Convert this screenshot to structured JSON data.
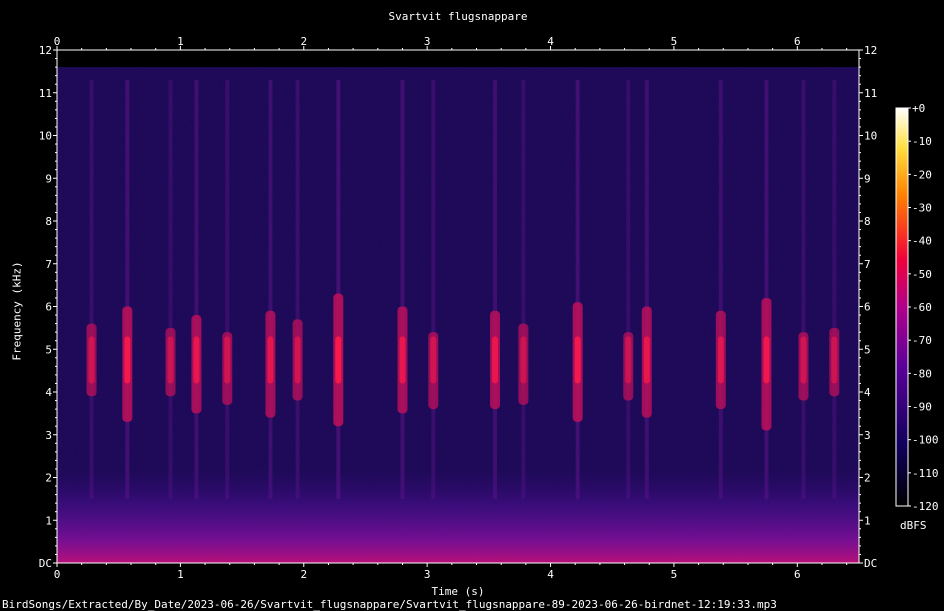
{
  "chart_data": {
    "type": "heatmap",
    "title": "Svartvit flugsnappare",
    "xlabel": "Time (s)",
    "ylabel": "Frequency (kHz)",
    "xlim": [
      0,
      6.5
    ],
    "ylim": [
      0,
      12
    ],
    "x_ticks": [
      "0",
      "1",
      "2",
      "3",
      "4",
      "5",
      "6"
    ],
    "y_ticks": [
      "DC",
      "1",
      "2",
      "3",
      "4",
      "5",
      "6",
      "7",
      "8",
      "9",
      "10",
      "11",
      "12"
    ],
    "colorbar": {
      "label": "dBFS",
      "ticks": [
        "+0",
        "-10",
        "-20",
        "-30",
        "-40",
        "-50",
        "-60",
        "-70",
        "-80",
        "-90",
        "-100",
        "-110",
        "-120"
      ],
      "range": [
        -120,
        0
      ],
      "colors": [
        "#000000",
        "#10005a",
        "#5a009a",
        "#b0008a",
        "#f0003a",
        "#ff8000",
        "#ffe040",
        "#ffffff"
      ]
    },
    "background_color": "#1a0b52",
    "calls": [
      {
        "t": 0.28,
        "f_low": 3.9,
        "f_high": 5.6,
        "level": 0.55
      },
      {
        "t": 0.57,
        "f_low": 3.3,
        "f_high": 6.0,
        "level": 0.85
      },
      {
        "t": 0.92,
        "f_low": 3.9,
        "f_high": 5.5,
        "level": 0.5
      },
      {
        "t": 1.13,
        "f_low": 3.5,
        "f_high": 5.8,
        "level": 0.75
      },
      {
        "t": 1.38,
        "f_low": 3.7,
        "f_high": 5.4,
        "level": 0.55
      },
      {
        "t": 1.73,
        "f_low": 3.4,
        "f_high": 5.9,
        "level": 0.7
      },
      {
        "t": 1.95,
        "f_low": 3.8,
        "f_high": 5.7,
        "level": 0.55
      },
      {
        "t": 2.28,
        "f_low": 3.2,
        "f_high": 6.3,
        "level": 0.9
      },
      {
        "t": 2.8,
        "f_low": 3.5,
        "f_high": 6.0,
        "level": 0.75
      },
      {
        "t": 3.05,
        "f_low": 3.6,
        "f_high": 5.4,
        "level": 0.55
      },
      {
        "t": 3.55,
        "f_low": 3.6,
        "f_high": 5.9,
        "level": 0.75
      },
      {
        "t": 3.78,
        "f_low": 3.7,
        "f_high": 5.6,
        "level": 0.5
      },
      {
        "t": 4.22,
        "f_low": 3.3,
        "f_high": 6.1,
        "level": 0.85
      },
      {
        "t": 4.63,
        "f_low": 3.8,
        "f_high": 5.4,
        "level": 0.5
      },
      {
        "t": 4.78,
        "f_low": 3.4,
        "f_high": 6.0,
        "level": 0.75
      },
      {
        "t": 5.38,
        "f_low": 3.6,
        "f_high": 5.9,
        "level": 0.65
      },
      {
        "t": 5.75,
        "f_low": 3.1,
        "f_high": 6.2,
        "level": 0.8
      },
      {
        "t": 6.05,
        "f_low": 3.8,
        "f_high": 5.4,
        "level": 0.55
      },
      {
        "t": 6.3,
        "f_low": 3.9,
        "f_high": 5.5,
        "level": 0.5
      }
    ]
  },
  "filename": "BirdSongs/Extracted/By_Date/2023-06-26/Svartvit_flugsnappare/Svartvit_flugsnappare-89-2023-06-26-birdnet-12:19:33.mp3"
}
